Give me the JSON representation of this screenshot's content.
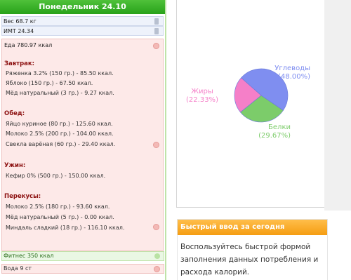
{
  "day": {
    "title": "Понедельник 24.10"
  },
  "metrics": {
    "weight": "Вес 68.7 кг",
    "bmi": "ИМТ 24.34"
  },
  "food": {
    "total": "Еда 780.97 ккал",
    "meals": [
      {
        "title": "Завтрак:",
        "items": [
          "Ряженка 3.2% (150 гр.) - 85.50 ккал.",
          "Яблоко (150 гр.) - 67.50 ккал.",
          "Мёд натуральный (3 гр.) - 9.27 ккал."
        ]
      },
      {
        "title": "Обед:",
        "items": [
          "Яйцо куриное (80 гр.) - 125.60 ккал.",
          "Молоко 2.5% (200 гр.) - 104.00 ккал.",
          "Свекла варёная (60 гр.) - 29.40 ккал."
        ]
      },
      {
        "title": "Ужин:",
        "items": [
          "Кефир 0% (500 гр.) - 150.00 ккал."
        ]
      },
      {
        "title": "Перекусы:",
        "items": [
          "Молоко 2.5% (180 гр.) - 93.60 ккал.",
          "Мёд натуральный (5 гр.) - 0.00 ккал.",
          "Миндаль сладкий (18 гр.) - 116.10 ккал."
        ]
      }
    ]
  },
  "fitness": "Фитнес 350 ккал",
  "water": "Вода 9 ст",
  "quick_entry": {
    "title": "Быстрый ввод за сегодня",
    "text": "Воспользуйтесь быстрой формой заполнения данных потребления и расхода калорий."
  },
  "chart_data": {
    "type": "pie",
    "slices": [
      {
        "name": "Углеводы",
        "label": "(48.00%)",
        "value": 48.0,
        "color": "#7f8ef0"
      },
      {
        "name": "Белки",
        "label": "(29.67%)",
        "value": 29.67,
        "color": "#7ccc6a"
      },
      {
        "name": "Жиры",
        "label": "(22.33%)",
        "value": 22.33,
        "color": "#f57fc8"
      }
    ]
  }
}
